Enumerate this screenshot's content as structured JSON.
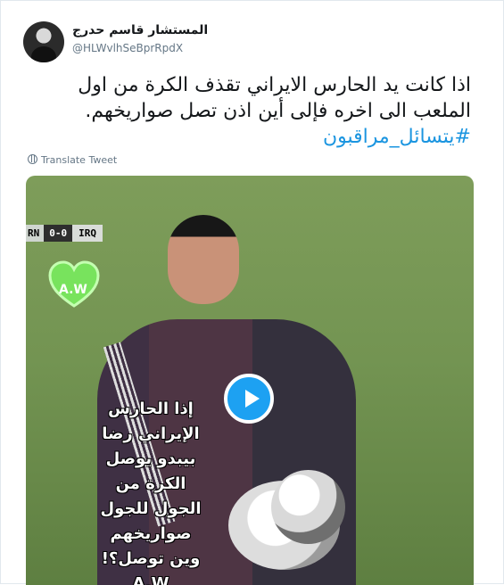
{
  "tweet": {
    "display_name": "المستشار قاسم حدرج",
    "handle": "@HLWvlhSeBprRpdX",
    "text": "اذا كانت يد الحارس الايراني تقذف الكرة من اول الملعب الى اخره فإلى أين اذن تصل صواريخهم.",
    "hashtag": "#يتسائل_مراقبون",
    "translate_label": "Translate Tweet"
  },
  "video": {
    "scoreboard_left": "RN",
    "score": "0-0",
    "scoreboard_right": "IRQ",
    "badge_text": "A.W",
    "overlay_lines": [
      "إذا الحارس",
      "الإيراني رضا",
      "بيبدو يوصل",
      "الكرة من",
      "الجول للجول",
      "صواريخهم",
      "وين توصل؟!",
      "A.W"
    ]
  },
  "icons": {
    "translate": "globe-icon",
    "video_play": "play-icon",
    "badge": "heart-icon"
  },
  "colors": {
    "link": "#1b95e0",
    "play_button": "#1da1f2",
    "text": "#14171a",
    "muted": "#657786"
  }
}
